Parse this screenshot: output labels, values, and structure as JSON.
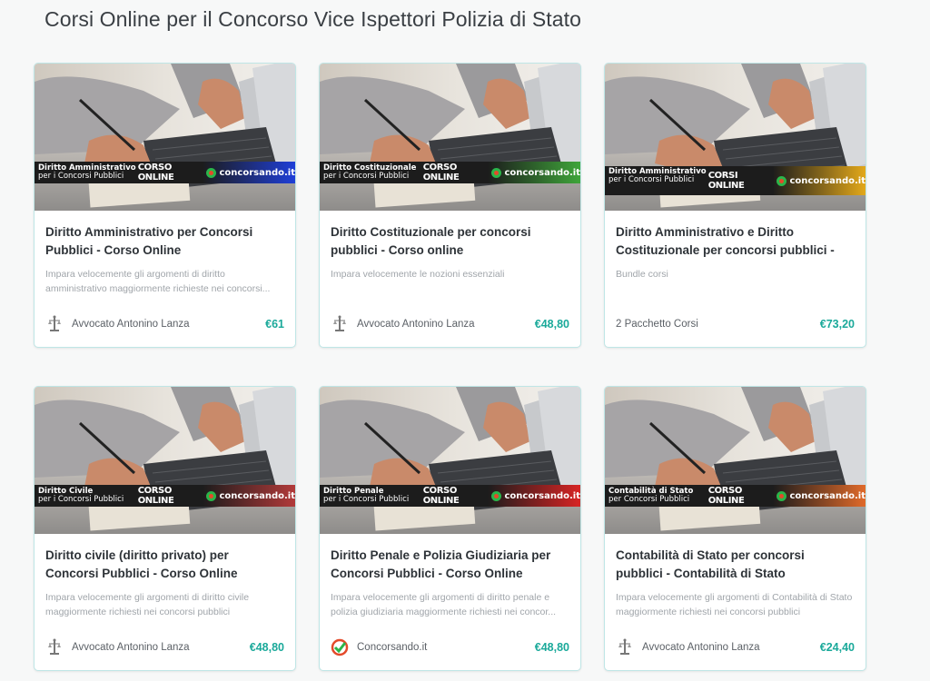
{
  "page_title": "Corsi Online per il Concorso Vice Ispettori Polizia di Stato",
  "courses": [
    {
      "banner_subject": "Diritto Amministrativo",
      "banner_sub": "per i Concorsi Pubblici",
      "banner_mid": "CORSO ONLINE",
      "banner_brand": "concorsando.it",
      "banner_color": "#1f3fd8",
      "title": "Diritto Amministrativo per Concorsi Pubblici - Corso Online",
      "description": "Impara velocemente gli argomenti di diritto amministrativo maggiormente richieste nei concorsi...",
      "author": "Avvocato Antonino Lanza",
      "author_icon": "justice-scales-icon",
      "price": "€61"
    },
    {
      "banner_subject": "Diritto Costituzionale",
      "banner_sub": "per i Concorsi Pubblici",
      "banner_mid": "CORSO ONLINE",
      "banner_brand": "concorsando.it",
      "banner_color": "#3fa53a",
      "title": "Diritto Costituzionale per concorsi pubblici - Corso online",
      "description": "Impara velocemente le nozioni essenziali",
      "author": "Avvocato Antonino Lanza",
      "author_icon": "justice-scales-icon",
      "price": "€48,80"
    },
    {
      "banner_subject": "Diritto Amministrativo e Costituzionale",
      "banner_sub": "per i Concorsi Pubblici",
      "banner_mid": "CORSI ONLINE",
      "banner_brand": "concorsando.it",
      "banner_color": "#e3a81a",
      "title": "Diritto Amministrativo e Diritto Costituzionale per concorsi pubblici -",
      "description": "Bundle corsi",
      "author": "2 Pacchetto Corsi",
      "author_icon": "",
      "price": "€73,20"
    },
    {
      "banner_subject": "Diritto Civile",
      "banner_sub": "per i Concorsi Pubblici",
      "banner_mid": "CORSO ONLINE",
      "banner_brand": "concorsando.it",
      "banner_color": "#b23a3a",
      "title": "Diritto civile (diritto privato) per Concorsi Pubblici - Corso Online",
      "description": "Impara velocemente gli argomenti di diritto civile maggiormente richiesti nei concorsi pubblici",
      "author": "Avvocato Antonino Lanza",
      "author_icon": "justice-scales-icon",
      "price": "€48,80"
    },
    {
      "banner_subject": "Diritto Penale",
      "banner_sub": "per i Concorsi Pubblici",
      "banner_mid": "CORSO ONLINE",
      "banner_brand": "concorsando.it",
      "banner_color": "#d82424",
      "title": "Diritto Penale e Polizia Giudiziaria per Concorsi Pubblici - Corso Online",
      "description": "Impara velocemente gli argomenti di diritto penale e polizia giudiziaria maggiormente richiesti nei concor...",
      "author": "Concorsando.it",
      "author_icon": "concorsando-logo-icon",
      "price": "€48,80"
    },
    {
      "banner_subject": "Contabilità di Stato",
      "banner_sub": "per Concorsi Pubblici",
      "banner_mid": "CORSO ONLINE",
      "banner_brand": "concorsando.it",
      "banner_color": "#e06a2a",
      "title": "Contabilità di Stato per concorsi pubblici - Contabilità di Stato",
      "description": "Impara velocemente gli argomenti di Contabilità di Stato maggiormente richiesti nei concorsi pubblici",
      "author": "Avvocato Antonino Lanza",
      "author_icon": "justice-scales-icon",
      "price": "€24,40"
    }
  ]
}
